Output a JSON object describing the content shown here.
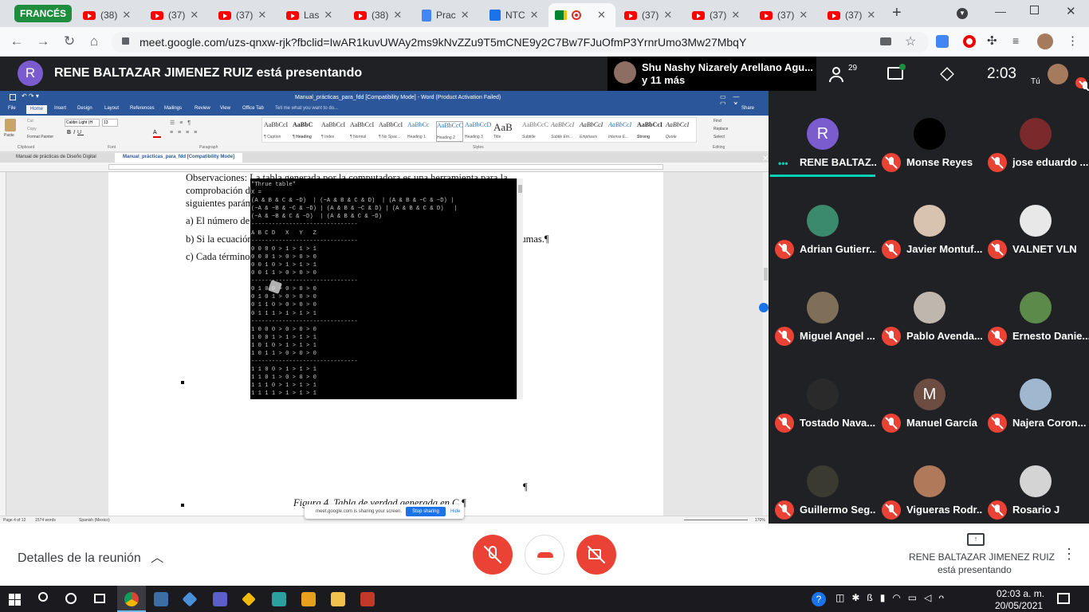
{
  "browser": {
    "tabs": [
      {
        "label": "FRANCÉS",
        "kind": "group"
      },
      {
        "label": "(38)",
        "kind": "youtube"
      },
      {
        "label": "(37)",
        "kind": "youtube"
      },
      {
        "label": "(37)",
        "kind": "youtube"
      },
      {
        "label": "Las",
        "kind": "youtube"
      },
      {
        "label": "(38)",
        "kind": "youtube"
      },
      {
        "label": "Prac",
        "kind": "docs"
      },
      {
        "label": "NTC",
        "kind": "generic"
      },
      {
        "label": "",
        "kind": "meet-active"
      },
      {
        "label": "(37)",
        "kind": "youtube"
      },
      {
        "label": "(37)",
        "kind": "youtube"
      },
      {
        "label": "(37)",
        "kind": "youtube"
      },
      {
        "label": "(37)",
        "kind": "youtube"
      }
    ],
    "url": "meet.google.com/uzs-qnxw-rjk?fbclid=IwAR1kuvUWAy2ms9kNvZZu9T5mCNE9y2C7Bw7FJuOfmP3YrnrUmo3Mw27MbqY"
  },
  "meet": {
    "presenter_initial": "R",
    "presenting_title": "RENE BALTAZAR JIMENEZ RUIZ está presentando",
    "notification": {
      "line1": "Shu Nashy Nizarely Arellano Agu...",
      "line2": "y 11 más"
    },
    "participant_count": "29",
    "time": "2:03",
    "you_label": "Tú",
    "participants": [
      {
        "name": "RENE BALTAZ...",
        "initial": "R",
        "color": "#7b5ccf",
        "speaking": true
      },
      {
        "name": "Monse Reyes",
        "initial": "",
        "color": "#000000"
      },
      {
        "name": "jose eduardo ...",
        "initial": "",
        "color": "#7a2a2a"
      },
      {
        "name": "Adrian Gutierr...",
        "initial": "",
        "color": "#3c8a6e"
      },
      {
        "name": "Javier Montuf...",
        "initial": "",
        "color": "#d8c2b0"
      },
      {
        "name": "VALNET VLN",
        "initial": "",
        "color": "#e8e8e8"
      },
      {
        "name": "Miguel Angel ...",
        "initial": "",
        "color": "#7f6f58"
      },
      {
        "name": "Pablo Avenda...",
        "initial": "",
        "color": "#bfb7ae"
      },
      {
        "name": "Ernesto Danie...",
        "initial": "",
        "color": "#5c8a4a"
      },
      {
        "name": "Tostado Nava...",
        "initial": "",
        "color": "#2a2a2a"
      },
      {
        "name": "Manuel García",
        "initial": "M",
        "color": "#6d4c41"
      },
      {
        "name": "Najera Coron...",
        "initial": "",
        "color": "#9fb8d0"
      },
      {
        "name": "Guillermo Seg...",
        "initial": "",
        "color": "#3a3a30"
      },
      {
        "name": "Vigueras Rodr...",
        "initial": "",
        "color": "#b07a5a"
      },
      {
        "name": "Rosario J",
        "initial": "",
        "color": "#d4d4d4"
      }
    ],
    "bottom": {
      "details": "Detalles de la reunión",
      "presenting_name": "RENE BALTAZAR JIMENEZ RUIZ",
      "presenting_sub": "está presentando"
    }
  },
  "word": {
    "title": "Manual_prácticas_para_fdd [Compatibility Mode] - Word (Product Activation Failed)",
    "tabs": [
      "File",
      "Home",
      "Insert",
      "Design",
      "Layout",
      "References",
      "Mailings",
      "Review",
      "View",
      "Office Tab"
    ],
    "tell_me": "Tell me what you want to do...",
    "share": "Share",
    "font": "Calibri Light (H",
    "font_size": "13",
    "styles": [
      {
        "sample": "AaBbCcI",
        "name": "¶ Caption"
      },
      {
        "sample": "AaBbC",
        "name": "¶ Heading"
      },
      {
        "sample": "AaBbCcI",
        "name": "¶ Index"
      },
      {
        "sample": "AaBbCcI",
        "name": "¶ Normal"
      },
      {
        "sample": "AaBbCcI",
        "name": "¶ No Spac..."
      },
      {
        "sample": "AaBbCc",
        "name": "Heading 1"
      },
      {
        "sample": "AaBbCcC",
        "name": "Heading 2"
      },
      {
        "sample": "AaBbCcD",
        "name": "Heading 3"
      },
      {
        "sample": "AaB",
        "name": "Title"
      },
      {
        "sample": "AaBbCcC",
        "name": "Subtitle"
      },
      {
        "sample": "AaBbCcI",
        "name": "Subtle Em..."
      },
      {
        "sample": "AaBbCcI",
        "name": "Emphasis"
      },
      {
        "sample": "AaBbCcI",
        "name": "Intense E..."
      },
      {
        "sample": "AaBbCcI",
        "name": "Strong"
      },
      {
        "sample": "AaBbCcI",
        "name": "Quote"
      }
    ],
    "groups": [
      "Clipboard",
      "Font",
      "Paragraph",
      "Styles",
      "Editing"
    ],
    "clipboard": {
      "paste": "Paste",
      "cut": "Cut",
      "copy": "Copy",
      "painter": "Format Painter"
    },
    "editing": {
      "find": "Find",
      "replace": "Replace",
      "select": "Select"
    },
    "doc_tabs": [
      "Manual de prácticas de Diseño Digital",
      "Manual_prácticas_para_fdd [Compatibility Mode]"
    ],
    "body": {
      "line1": "Observaciones: La tabla generada por la computadora es una herramienta para la",
      "line2": "comprobación de los ejercicios que se ven en clase. El programa pide al usuario los",
      "line3": "siguientes parámetros:¶",
      "item_a": "a) El número de variables de entrada¶",
      "item_b": "b) Si la ecuación que será introducida está como Suma de productos o producto de sumas.¶",
      "item_c": "c) Cada término de la ecuación.¶",
      "caption": "Figura 4. Tabla de verdad generada en C.¶"
    },
    "terminal": "\"Thrue table\"\nX =\n(A & B & C & ~D)  | (~A & B & C & D)  | (A & B & ~C & ~D) |\n(~A & ~B & ~C & ~D) | (A & B & ~C & D) | (A & B & C & D)   |\n(~A & ~B & C & ~D)  | (A & B & C & ~D)\n-------------------------------\nA B C D   X   Y   Z\n-------------------------------\n0 0 0 0 > 1 > 1 > 1\n0 0 0 1 > 0 > 0 > 0\n0 0 1 0 > 1 > 1 > 1\n0 0 1 1 > 0 > 0 > 0\n-------------------------------\n0 1 0 0 > 0 > 0 > 0\n0 1 0 1 > 0 > 0 > 0\n0 1 1 0 > 0 > 0 > 0\n0 1 1 1 > 1 > 1 > 1\n-------------------------------\n1 0 0 0 > 0 > 0 > 0\n1 0 0 1 > 1 > 1 > 1\n1 0 1 0 > 1 > 1 > 1\n1 0 1 1 > 0 > 0 > 0\n-------------------------------\n1 1 0 0 > 1 > 1 > 1\n1 1 0 1 > 0 > 0 > 0\n1 1 1 0 > 1 > 1 > 1\n1 1 1 1 > 1 > 1 > 1\n-------------------------------",
    "status": {
      "page": "Page 4 of 12",
      "words": "1574 words",
      "lang": "Spanish (Mexico)",
      "zoom": "170%"
    },
    "share_popup": {
      "text": "meet.google.com is sharing your screen.",
      "stop": "Stop sharing",
      "hide": "Hide"
    }
  },
  "taskbar": {
    "time": "02:03 a. m.",
    "date": "20/05/2021"
  }
}
